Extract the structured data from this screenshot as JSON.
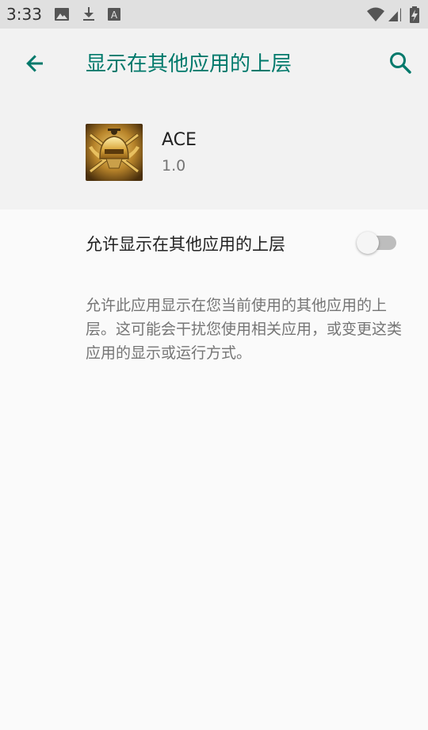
{
  "status_bar": {
    "time": "3:33",
    "icons": [
      "image-icon",
      "download-icon",
      "a-badge-icon",
      "wifi-icon",
      "signal-icon",
      "battery-icon"
    ]
  },
  "app_bar": {
    "title": "显示在其他应用的上层",
    "accent_color": "#00796b"
  },
  "app_info": {
    "name": "ACE",
    "version": "1.0"
  },
  "preference": {
    "label": "允许显示在其他应用的上层",
    "enabled": false
  },
  "summary": "允许此应用显示在您当前使用的其他应用的上层。这可能会干扰您使用相关应用，或变更这类应用的显示或运行方式。"
}
